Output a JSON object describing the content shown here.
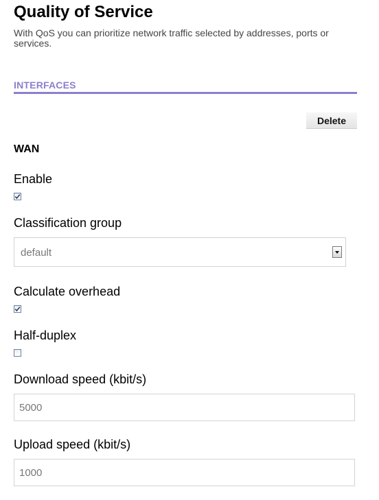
{
  "page": {
    "title": "Quality of Service",
    "description": "With QoS you can prioritize network traffic selected by addresses, ports or services."
  },
  "section": {
    "title": "INTERFACES"
  },
  "actions": {
    "delete_label": "Delete"
  },
  "interface": {
    "name": "WAN",
    "enable": {
      "label": "Enable",
      "checked": true
    },
    "classification_group": {
      "label": "Classification group",
      "value": "default"
    },
    "calculate_overhead": {
      "label": "Calculate overhead",
      "checked": true
    },
    "half_duplex": {
      "label": "Half-duplex",
      "checked": false
    },
    "download_speed": {
      "label": "Download speed (kbit/s)",
      "value": "5000"
    },
    "upload_speed": {
      "label": "Upload speed (kbit/s)",
      "value": "1000"
    }
  },
  "colors": {
    "accent": "#8b7fcf"
  }
}
